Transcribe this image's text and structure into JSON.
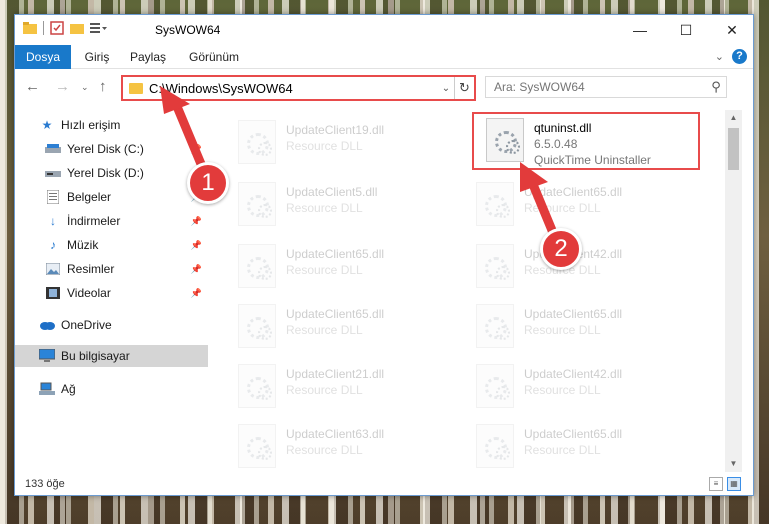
{
  "window": {
    "title": "SysWOW64",
    "controls": {
      "minimize": "—",
      "maximize": "☐",
      "close": "✕"
    }
  },
  "ribbon": {
    "tabs": [
      {
        "label": "Dosya",
        "active": true
      },
      {
        "label": "Giriş",
        "active": false
      },
      {
        "label": "Paylaş",
        "active": false
      },
      {
        "label": "Görünüm",
        "active": false
      }
    ],
    "help": "?"
  },
  "navigation": {
    "address": "C:\\Windows\\SysWOW64",
    "search_placeholder": "Ara: SysWOW64"
  },
  "sidebar": {
    "items": [
      {
        "label": "Hızlı erişim",
        "icon": "star-icon"
      },
      {
        "label": "Yerel Disk (C:)",
        "icon": "drive-icon",
        "pinned": true
      },
      {
        "label": "Yerel Disk (D:)",
        "icon": "drive-icon"
      },
      {
        "label": "Belgeler",
        "icon": "documents-icon",
        "pinned": true
      },
      {
        "label": "İndirmeler",
        "icon": "download-icon",
        "pinned": true
      },
      {
        "label": "Müzik",
        "icon": "music-icon",
        "pinned": true
      },
      {
        "label": "Resimler",
        "icon": "pictures-icon",
        "pinned": true
      },
      {
        "label": "Videolar",
        "icon": "videos-icon",
        "pinned": true
      },
      {
        "label": "OneDrive",
        "icon": "cloud-icon"
      },
      {
        "label": "Bu bilgisayar",
        "icon": "computer-icon",
        "selected": true
      },
      {
        "label": "Ağ",
        "icon": "network-icon"
      }
    ]
  },
  "files": [
    {
      "name": "UpdateClient19.dll",
      "sub": "Resource DLL"
    },
    {
      "name": "qtuninst.dll",
      "version": "6.5.0.48",
      "description": "QuickTime Uninstaller",
      "highlighted": true
    },
    {
      "name": "UpdateClient5.dll",
      "sub": "Resource DLL"
    },
    {
      "name": "UpdateClient65.dll",
      "sub": "Resource DLL"
    },
    {
      "name": "UpdateClient65.dll",
      "sub": "Resource DLL"
    },
    {
      "name": "UpdateClient42.dll",
      "sub": "Resource DLL"
    },
    {
      "name": "UpdateClient65.dll",
      "sub": "Resource DLL"
    },
    {
      "name": "UpdateClient65.dll",
      "sub": "Resource DLL"
    },
    {
      "name": "UpdateClient21.dll",
      "sub": "Resource DLL"
    },
    {
      "name": "UpdateClient42.dll",
      "sub": "Resource DLL"
    },
    {
      "name": "UpdateClient63.dll",
      "sub": "Resource DLL"
    },
    {
      "name": "UpdateClient65.dll",
      "sub": "Resource DLL"
    }
  ],
  "status": {
    "count": "133 öğe"
  },
  "annotations": {
    "step1": "1",
    "step2": "2",
    "color": "#e23b3b"
  }
}
